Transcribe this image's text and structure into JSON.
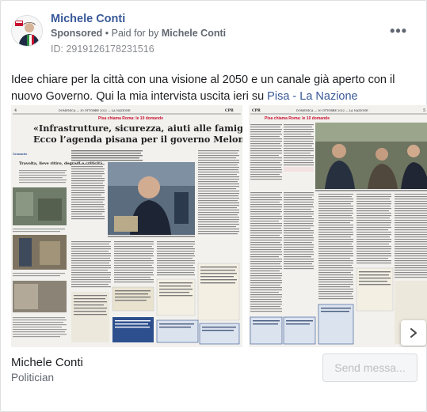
{
  "post": {
    "author": "Michele Conti",
    "sponsored": "Sponsored",
    "paid_for_prefix": " • Paid for by ",
    "paid_for_name": "Michele Conti",
    "id_line": "ID: 2919126178231516",
    "body_text": "Idee chiare per la città con una visione al 2050 e un canale già aperto con il nuovo Governo. Qui la mia intervista uscita ieri su ",
    "link_text": "Pisa - La Nazione",
    "more_icon": "more-options-icon"
  },
  "slides": [
    {
      "section": "Pisa chiama Roma: le 10 domande",
      "headline_1": "«Infrastrutture, sicurezza, aiuti alle famiglie",
      "headline_2": "Ecco l’agenda pisana per il governo Meloni»",
      "header_left": "4",
      "header_center": "DOMENICA — 30 OTTOBRE 2022 — LA NAZIONE",
      "header_right": "CPR",
      "sidebar_title": "Travolta, lieve ritiro, degradi e criticità"
    },
    {
      "section": "Pisa chiama Roma: le 10 domande",
      "header_left": "CPR",
      "header_center": "DOMENICA — 30 OTTOBRE 2022 — LA NAZIONE",
      "header_right": "5"
    }
  ],
  "footer": {
    "name": "Michele Conti",
    "role": "Politician",
    "send_button": "Send messa..."
  },
  "colors": {
    "link": "#385898",
    "section_red": "#c8102e",
    "box_blue": "#2d4f8e"
  }
}
